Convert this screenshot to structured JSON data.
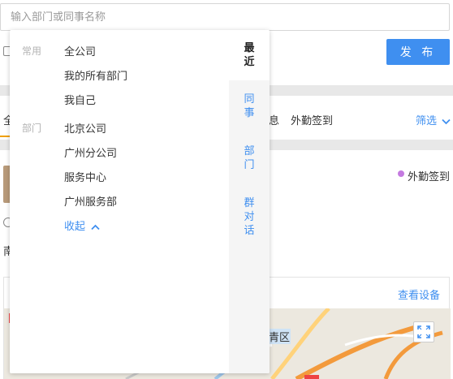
{
  "search": {
    "placeholder": "输入部门或同事名称",
    "value": ""
  },
  "header": {
    "publish_label": "发 布"
  },
  "tabs": {
    "first": "全",
    "messages": "息",
    "field_checkin": "外勤签到"
  },
  "filter": {
    "label": "筛选"
  },
  "record": {
    "status": "外勤签到",
    "status_color": "#c47ae0",
    "char": "南"
  },
  "map": {
    "device_link": "查看设备",
    "district": "青区"
  },
  "dropdown": {
    "groups": [
      {
        "label": "常用",
        "items": [
          "全公司",
          "我的所有部门",
          "我自己"
        ]
      },
      {
        "label": "部门",
        "items": [
          "北京公司",
          "广州分公司",
          "服务中心",
          "广州服务部"
        ]
      }
    ],
    "collapse_label": "收起",
    "side_tabs": [
      {
        "label": [
          "最",
          "近"
        ],
        "active": true
      },
      {
        "label": [
          "同",
          "事"
        ],
        "active": false
      },
      {
        "label": [
          "部",
          "门"
        ],
        "active": false
      },
      {
        "label": [
          "群",
          "对",
          "话"
        ],
        "active": false
      }
    ]
  },
  "colors": {
    "accent": "#3f8ff0",
    "tab_indicator": "#f0a000",
    "panel_bg": "#f5f5f5"
  }
}
